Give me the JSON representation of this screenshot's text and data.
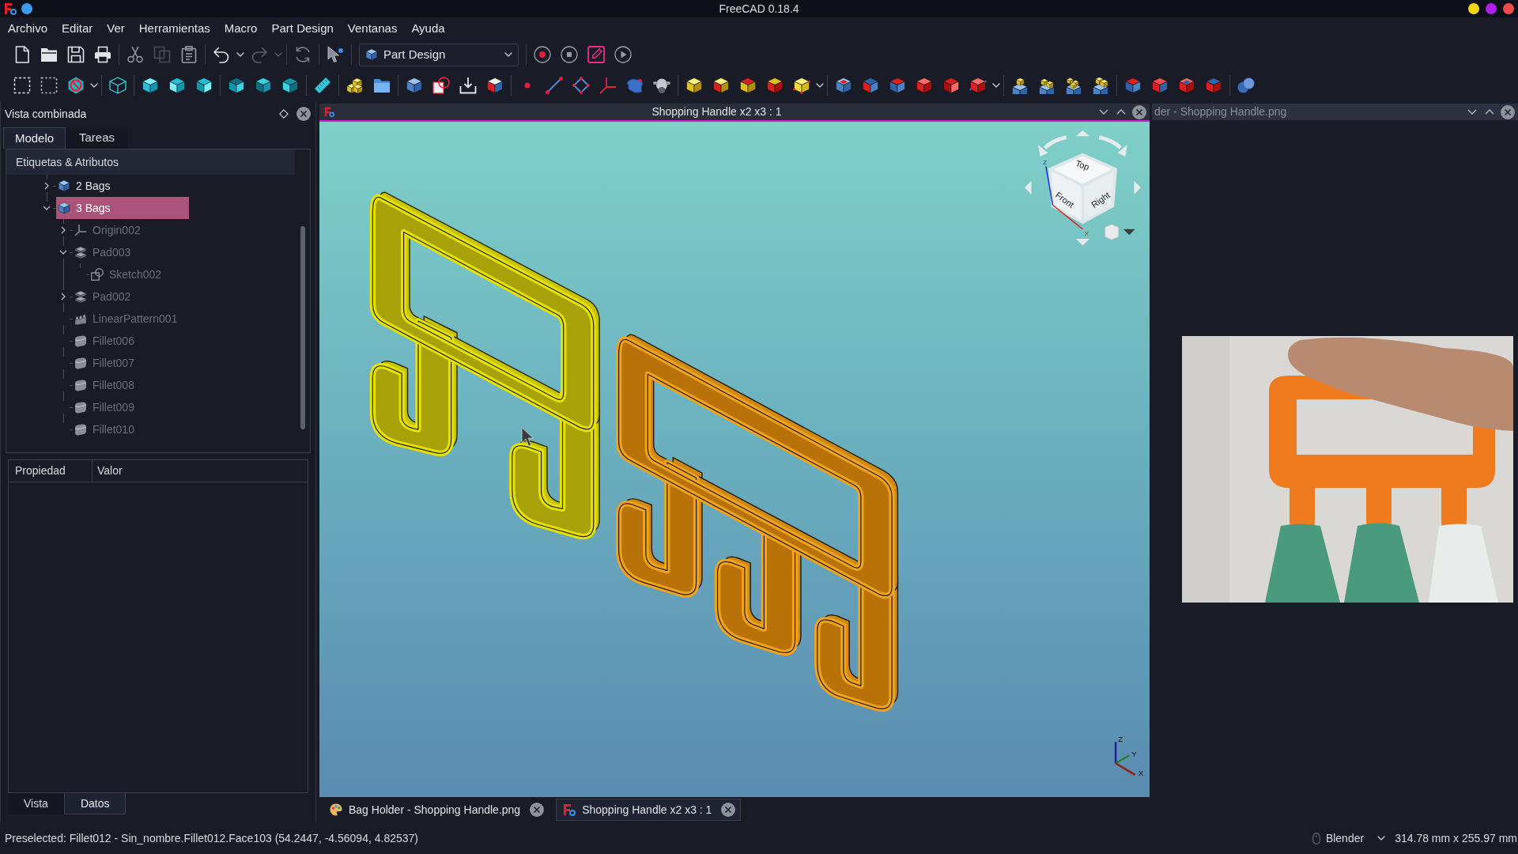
{
  "window": {
    "title": "FreeCAD 0.18.4"
  },
  "menu": [
    "Archivo",
    "Editar",
    "Ver",
    "Herramientas",
    "Macro",
    "Part Design",
    "Ventanas",
    "Ayuda"
  ],
  "toolbar": {
    "workbench": "Part Design",
    "copy_disabled": true,
    "redo_disabled": true
  },
  "combo_view": {
    "title": "Vista combinada",
    "tabs": [
      {
        "label": "Modelo",
        "selected": true
      },
      {
        "label": "Tareas",
        "selected": false
      }
    ],
    "tree_header": "Etiquetas & Atributos",
    "tree": [
      {
        "label": "2 Bags",
        "kind": "body",
        "expanded": false,
        "dimmed": false,
        "selected": false
      },
      {
        "label": "3 Bags",
        "kind": "body",
        "expanded": true,
        "dimmed": false,
        "selected": true,
        "children": [
          {
            "label": "Origin002",
            "kind": "origin",
            "expanded": false,
            "dimmed": true,
            "selected": false
          },
          {
            "label": "Pad003",
            "kind": "pad",
            "expanded": true,
            "dimmed": true,
            "selected": false,
            "children": [
              {
                "label": "Sketch002",
                "kind": "sketch",
                "dimmed": true,
                "selected": false
              }
            ]
          },
          {
            "label": "Pad002",
            "kind": "pad",
            "expanded": false,
            "dimmed": true,
            "selected": false
          },
          {
            "label": "LinearPattern001",
            "kind": "pattern",
            "dimmed": true,
            "selected": false
          },
          {
            "label": "Fillet006",
            "kind": "fillet",
            "dimmed": true,
            "selected": false
          },
          {
            "label": "Fillet007",
            "kind": "fillet",
            "dimmed": true,
            "selected": false
          },
          {
            "label": "Fillet008",
            "kind": "fillet",
            "dimmed": true,
            "selected": false
          },
          {
            "label": "Fillet009",
            "kind": "fillet",
            "dimmed": true,
            "selected": false
          },
          {
            "label": "Fillet010",
            "kind": "fillet",
            "dimmed": true,
            "selected": false
          }
        ]
      }
    ],
    "property_columns": [
      "Propiedad",
      "Valor"
    ],
    "property_tabs": [
      {
        "label": "Vista",
        "selected": false
      },
      {
        "label": "Datos",
        "selected": true
      }
    ]
  },
  "model_view": {
    "title": "Shopping Handle x2 x3 : 1",
    "active": true,
    "nav_cube": {
      "faces": [
        "Top",
        "Front",
        "Right"
      ],
      "axes": [
        "Z",
        "X"
      ]
    },
    "axis_triad": [
      "Z",
      "Y",
      "X"
    ]
  },
  "image_view": {
    "title": "der - Shopping Handle.png"
  },
  "document_tabs": [
    {
      "label": "Bag Holder - Shopping Handle.png",
      "kind": "image",
      "selected": false
    },
    {
      "label": "Shopping Handle x2 x3 : 1",
      "kind": "model",
      "selected": true
    }
  ],
  "status_bar": {
    "message": "Preselected: Fillet012 - Sin_nombre.Fillet012.Face103 (54.2447, -4.56094, 4.82537)",
    "navigation": "Blender",
    "dimensions": "314.78 mm x 255.97 mm"
  }
}
